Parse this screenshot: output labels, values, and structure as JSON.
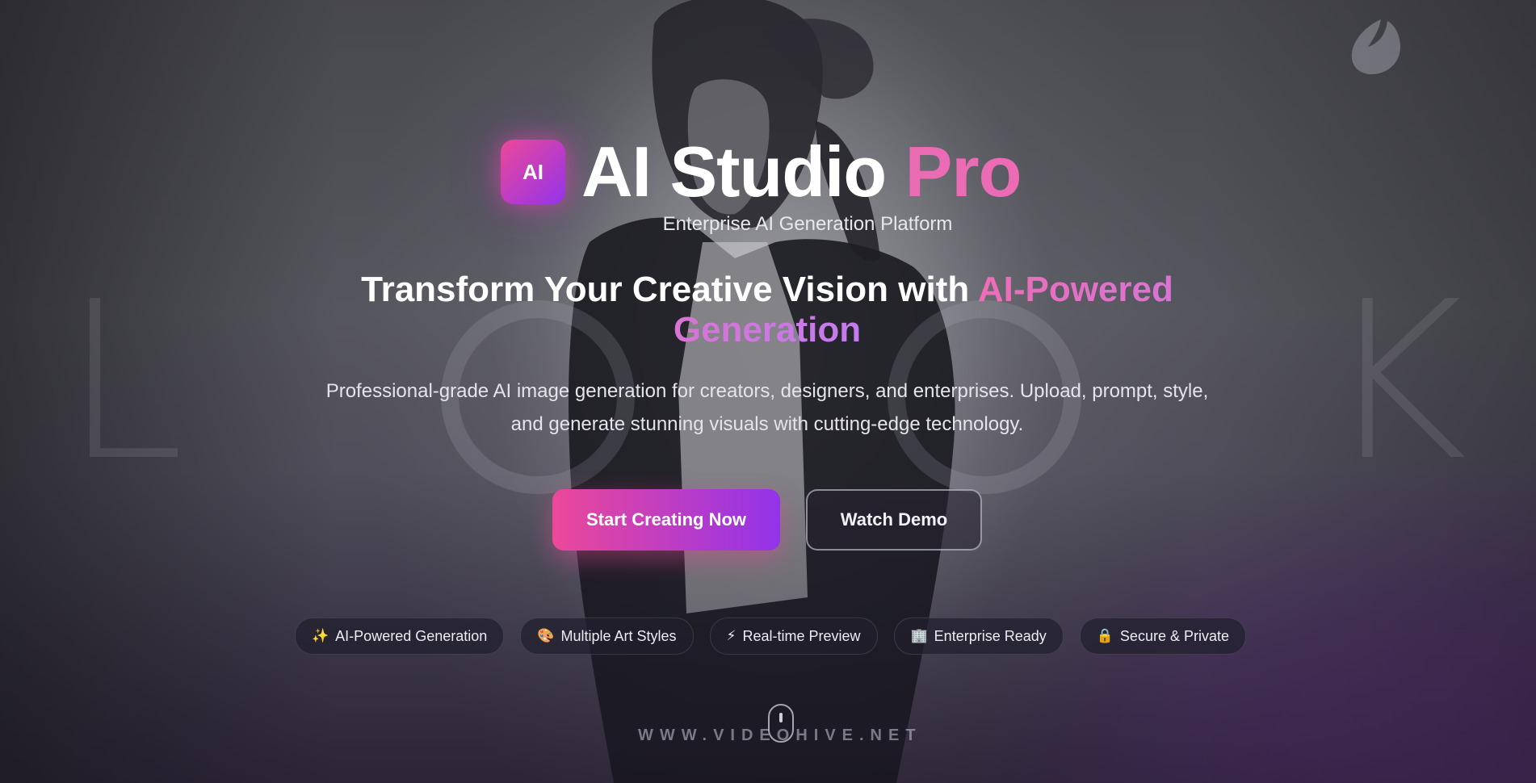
{
  "brand": {
    "badge_text": "AI",
    "title_main": "AI Studio",
    "title_accent": "Pro",
    "tagline": "Enterprise AI Generation Platform"
  },
  "hero": {
    "headline_main": "Transform Your Creative Vision with",
    "headline_accent": "AI-Powered Generation",
    "subtext": "Professional-grade AI image generation for creators, designers, and enterprises. Upload, prompt, style, and generate stunning visuals with cutting-edge technology."
  },
  "cta": {
    "primary_label": "Start Creating Now",
    "secondary_label": "Watch Demo"
  },
  "features": [
    {
      "icon": "✨",
      "icon_name": "sparkles-icon",
      "label": "AI-Powered Generation"
    },
    {
      "icon": "🎨",
      "icon_name": "palette-icon",
      "label": "Multiple Art Styles"
    },
    {
      "icon": "⚡",
      "icon_name": "lightning-icon",
      "label": "Real-time Preview"
    },
    {
      "icon": "🏢",
      "icon_name": "building-icon",
      "label": "Enterprise Ready"
    },
    {
      "icon": "🔒",
      "icon_name": "lock-icon",
      "label": "Secure & Private"
    }
  ],
  "background": {
    "look_letters": [
      "L",
      "O",
      "O",
      "K"
    ],
    "watermark_text": "WWW.VIDEOHIVE.NET"
  },
  "colors": {
    "accent_pink": "#ec4899",
    "accent_purple": "#9333ea",
    "title_accent": "#ec6bb5"
  }
}
